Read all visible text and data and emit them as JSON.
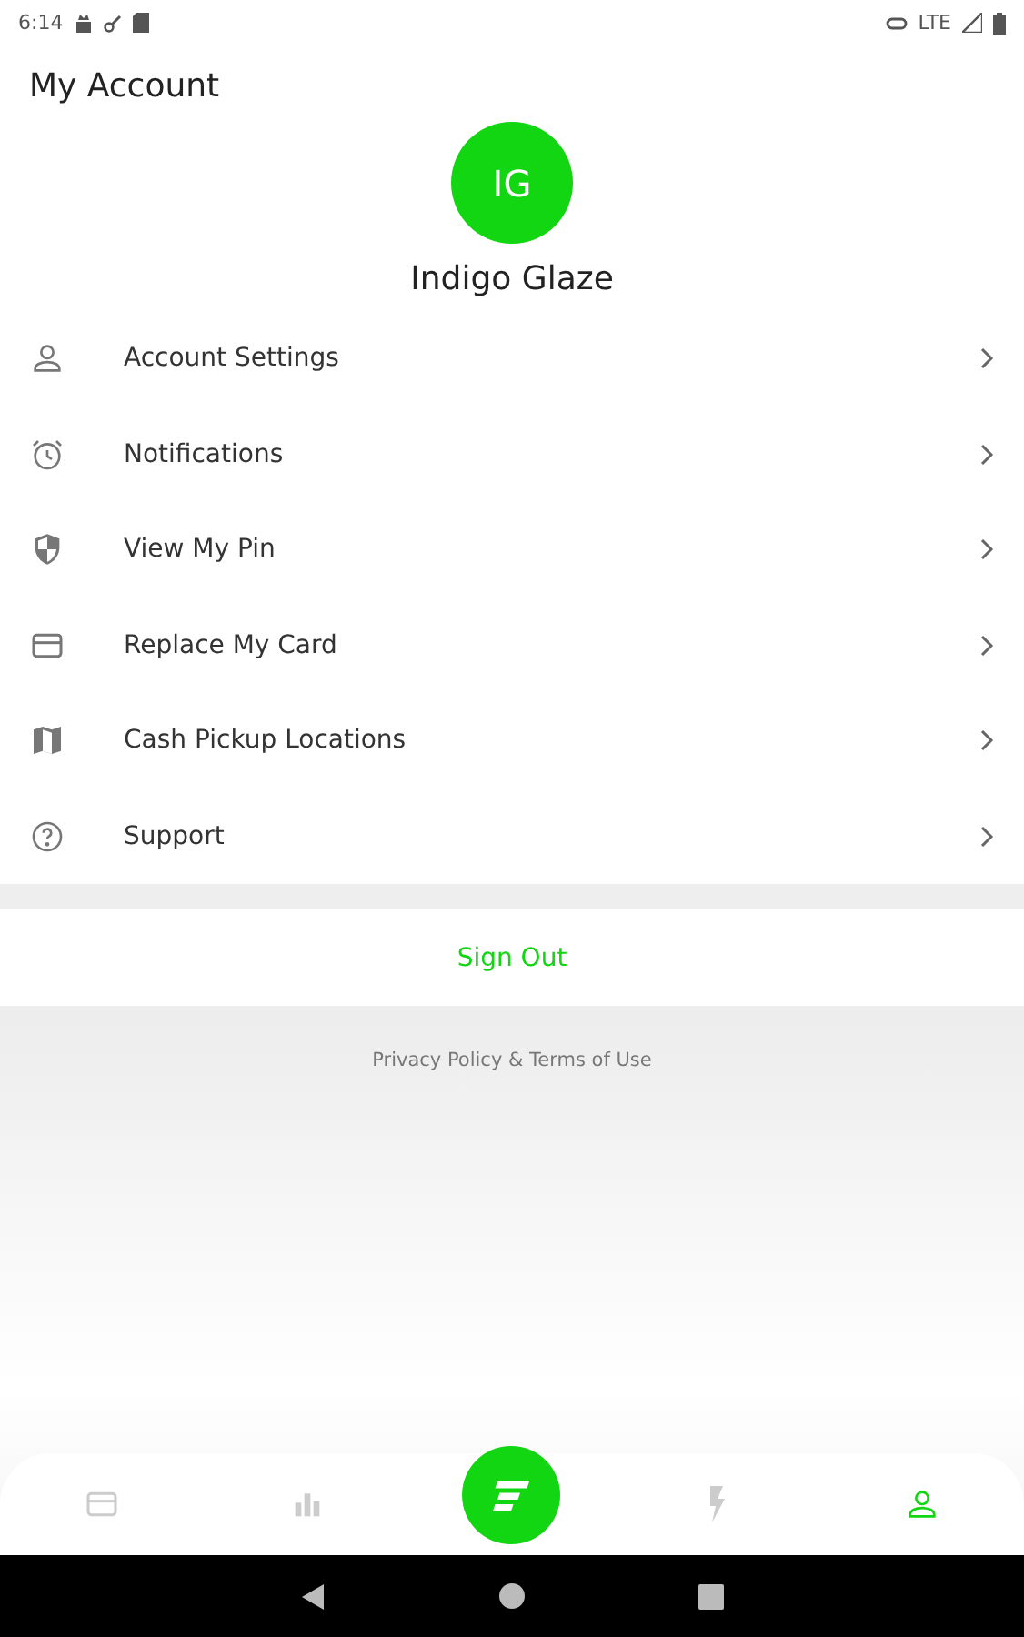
{
  "status_bar": {
    "time": "6:14",
    "network": "LTE"
  },
  "title": "My Account",
  "profile": {
    "initials": "IG",
    "name": "Indigo Glaze"
  },
  "menu": [
    {
      "kind": "person",
      "label": "Account Settings"
    },
    {
      "kind": "alarm",
      "label": "Notifications"
    },
    {
      "kind": "shield",
      "label": "View My Pin"
    },
    {
      "kind": "card",
      "label": "Replace My Card"
    },
    {
      "kind": "map",
      "label": "Cash Pickup Locations"
    },
    {
      "kind": "help",
      "label": "Support"
    }
  ],
  "sign_out": "Sign Out",
  "footer_link": "Privacy Policy & Terms of Use",
  "bottom_nav": [
    {
      "kind": "card",
      "selected": false
    },
    {
      "kind": "chart",
      "selected": false
    },
    {
      "kind": "logo",
      "selected": false
    },
    {
      "kind": "bolt",
      "selected": false
    },
    {
      "kind": "person",
      "selected": true
    }
  ]
}
